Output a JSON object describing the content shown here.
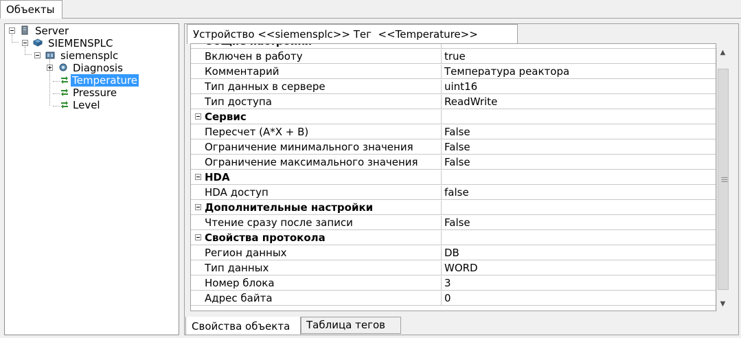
{
  "top_tab": "Объекты",
  "tree": {
    "server": "Server",
    "plc_group": "SIEMENSPLC",
    "plc": "siemensplc",
    "diagnosis": "Diagnosis",
    "temperature": "Temperature",
    "pressure": "Pressure",
    "level": "Level"
  },
  "device_tab": "Устройство <<siemensplc>> Тег  <<Temperature>>",
  "grid": {
    "partial_category": "Общие настройки",
    "rows": [
      {
        "name": "Включен в работу",
        "value": "true"
      },
      {
        "name": "Комментарий",
        "value": "Температура реактора"
      },
      {
        "name": "Тип данных в сервере",
        "value": "uint16"
      },
      {
        "name": "Тип доступа",
        "value": "ReadWrite"
      },
      {
        "category": "Сервис"
      },
      {
        "name": "Пересчет (A*X + B)",
        "value": "False"
      },
      {
        "name": "Ограничение минимального значения",
        "value": "False"
      },
      {
        "name": "Ограничение максимального значения",
        "value": "False"
      },
      {
        "category": "HDA"
      },
      {
        "name": "HDA доступ",
        "value": "false"
      },
      {
        "category": "Дополнительные настройки"
      },
      {
        "name": "Чтение сразу после записи",
        "value": "False"
      },
      {
        "category": "Свойства протокола"
      },
      {
        "name": "Регион данных",
        "value": "DB"
      },
      {
        "name": "Тип данных",
        "value": "WORD"
      },
      {
        "name": "Номер блока",
        "value": "3"
      },
      {
        "name": "Адрес байта",
        "value": "0"
      }
    ]
  },
  "bottom_tabs": [
    "Свойства объекта",
    "Таблица тегов"
  ],
  "colors": {
    "selection": "#3399ff",
    "window_bg": "#f0f0f0"
  }
}
